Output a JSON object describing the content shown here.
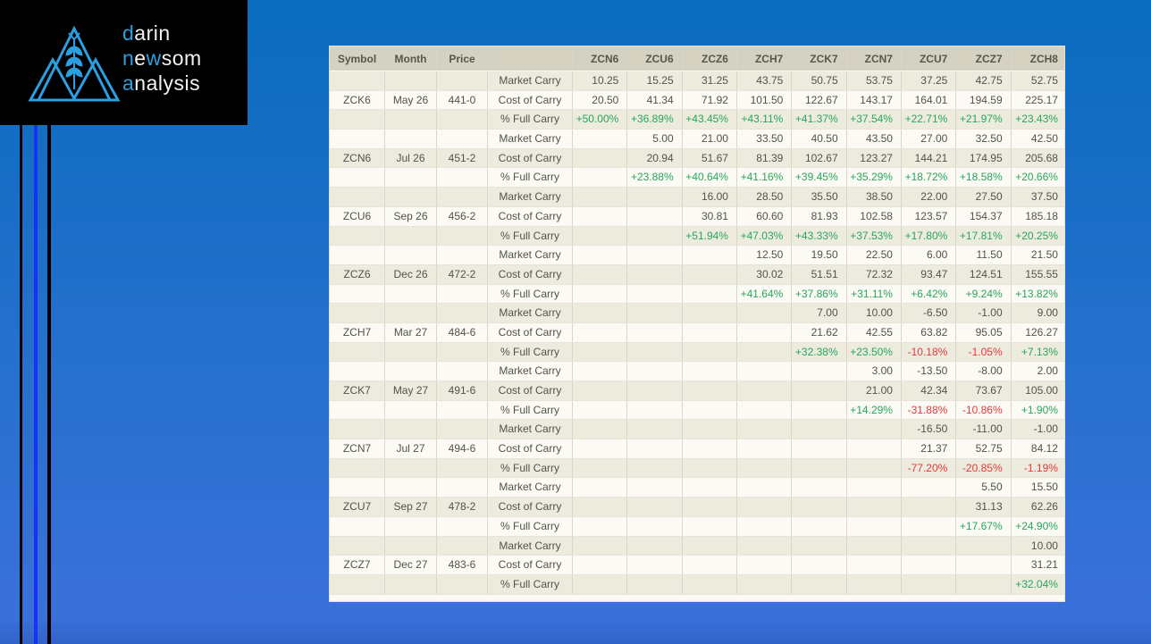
{
  "logo": {
    "accent_color": "#2b9fe0",
    "lines": [
      [
        {
          "text": "d",
          "accent": true
        },
        {
          "text": "arin",
          "accent": false
        }
      ],
      [
        {
          "text": "n",
          "accent": true
        },
        {
          "text": "e",
          "accent": false
        },
        {
          "text": "w",
          "accent": true
        },
        {
          "text": "som",
          "accent": false
        }
      ],
      [
        {
          "text": "a",
          "accent": true
        },
        {
          "text": "nalysis",
          "accent": false
        }
      ]
    ]
  },
  "decor": {
    "background_top": "#0a6cbe",
    "background_bottom": "#3a70da",
    "accent_line_blue": "#1533f0",
    "accent_line_black": "#000000"
  },
  "chart_data": {
    "type": "table",
    "columns": [
      "Symbol",
      "Month",
      "Price",
      "",
      "ZCN6",
      "ZCU6",
      "ZCZ6",
      "ZCH7",
      "ZCK7",
      "ZCN7",
      "ZCU7",
      "ZCZ7",
      "ZCH8"
    ],
    "row_labels": {
      "market": "Market Carry",
      "cost": "Cost of Carry",
      "pct": "% Full Carry"
    },
    "value_colors": {
      "positive": "#28a75c",
      "negative": "#e23b3b",
      "neutral": "#53524a"
    },
    "groups": [
      {
        "symbol": "ZCK6",
        "month": "May 26",
        "price": "441-0",
        "market": [
          "10.25",
          "15.25",
          "31.25",
          "43.75",
          "50.75",
          "53.75",
          "37.25",
          "42.75",
          "52.75"
        ],
        "cost": [
          "20.50",
          "41.34",
          "71.92",
          "101.50",
          "122.67",
          "143.17",
          "164.01",
          "194.59",
          "225.17"
        ],
        "pct": [
          "+50.00%",
          "+36.89%",
          "+43.45%",
          "+43.11%",
          "+41.37%",
          "+37.54%",
          "+22.71%",
          "+21.97%",
          "+23.43%"
        ]
      },
      {
        "symbol": "ZCN6",
        "month": "Jul 26",
        "price": "451-2",
        "market": [
          "",
          "5.00",
          "21.00",
          "33.50",
          "40.50",
          "43.50",
          "27.00",
          "32.50",
          "42.50"
        ],
        "cost": [
          "",
          "20.94",
          "51.67",
          "81.39",
          "102.67",
          "123.27",
          "144.21",
          "174.95",
          "205.68"
        ],
        "pct": [
          "",
          "+23.88%",
          "+40.64%",
          "+41.16%",
          "+39.45%",
          "+35.29%",
          "+18.72%",
          "+18.58%",
          "+20.66%"
        ]
      },
      {
        "symbol": "ZCU6",
        "month": "Sep 26",
        "price": "456-2",
        "market": [
          "",
          "",
          "16.00",
          "28.50",
          "35.50",
          "38.50",
          "22.00",
          "27.50",
          "37.50"
        ],
        "cost": [
          "",
          "",
          "30.81",
          "60.60",
          "81.93",
          "102.58",
          "123.57",
          "154.37",
          "185.18"
        ],
        "pct": [
          "",
          "",
          "+51.94%",
          "+47.03%",
          "+43.33%",
          "+37.53%",
          "+17.80%",
          "+17.81%",
          "+20.25%"
        ]
      },
      {
        "symbol": "ZCZ6",
        "month": "Dec 26",
        "price": "472-2",
        "market": [
          "",
          "",
          "",
          "12.50",
          "19.50",
          "22.50",
          "6.00",
          "11.50",
          "21.50"
        ],
        "cost": [
          "",
          "",
          "",
          "30.02",
          "51.51",
          "72.32",
          "93.47",
          "124.51",
          "155.55"
        ],
        "pct": [
          "",
          "",
          "",
          "+41.64%",
          "+37.86%",
          "+31.11%",
          "+6.42%",
          "+9.24%",
          "+13.82%"
        ]
      },
      {
        "symbol": "ZCH7",
        "month": "Mar 27",
        "price": "484-6",
        "market": [
          "",
          "",
          "",
          "",
          "7.00",
          "10.00",
          "-6.50",
          "-1.00",
          "9.00"
        ],
        "cost": [
          "",
          "",
          "",
          "",
          "21.62",
          "42.55",
          "63.82",
          "95.05",
          "126.27"
        ],
        "pct": [
          "",
          "",
          "",
          "",
          "+32.38%",
          "+23.50%",
          "-10.18%",
          "-1.05%",
          "+7.13%"
        ]
      },
      {
        "symbol": "ZCK7",
        "month": "May 27",
        "price": "491-6",
        "market": [
          "",
          "",
          "",
          "",
          "",
          "3.00",
          "-13.50",
          "-8.00",
          "2.00"
        ],
        "cost": [
          "",
          "",
          "",
          "",
          "",
          "21.00",
          "42.34",
          "73.67",
          "105.00"
        ],
        "pct": [
          "",
          "",
          "",
          "",
          "",
          "+14.29%",
          "-31.88%",
          "-10.86%",
          "+1.90%"
        ]
      },
      {
        "symbol": "ZCN7",
        "month": "Jul 27",
        "price": "494-6",
        "market": [
          "",
          "",
          "",
          "",
          "",
          "",
          "-16.50",
          "-11.00",
          "-1.00"
        ],
        "cost": [
          "",
          "",
          "",
          "",
          "",
          "",
          "21.37",
          "52.75",
          "84.12"
        ],
        "pct": [
          "",
          "",
          "",
          "",
          "",
          "",
          "-77.20%",
          "-20.85%",
          "-1.19%"
        ]
      },
      {
        "symbol": "ZCU7",
        "month": "Sep 27",
        "price": "478-2",
        "market": [
          "",
          "",
          "",
          "",
          "",
          "",
          "",
          "5.50",
          "15.50"
        ],
        "cost": [
          "",
          "",
          "",
          "",
          "",
          "",
          "",
          "31.13",
          "62.26"
        ],
        "pct": [
          "",
          "",
          "",
          "",
          "",
          "",
          "",
          "+17.67%",
          "+24.90%"
        ]
      },
      {
        "symbol": "ZCZ7",
        "month": "Dec 27",
        "price": "483-6",
        "market": [
          "",
          "",
          "",
          "",
          "",
          "",
          "",
          "",
          "10.00"
        ],
        "cost": [
          "",
          "",
          "",
          "",
          "",
          "",
          "",
          "",
          "31.21"
        ],
        "pct": [
          "",
          "",
          "",
          "",
          "",
          "",
          "",
          "",
          "+32.04%"
        ]
      }
    ]
  }
}
